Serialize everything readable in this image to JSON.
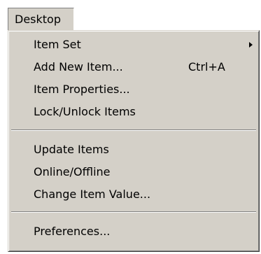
{
  "menubar": {
    "title": "Desktop"
  },
  "menu": {
    "items": [
      {
        "label": "Item Set",
        "shortcut": "",
        "submenu": true
      },
      {
        "label": "Add New Item...",
        "shortcut": "Ctrl+A",
        "submenu": false
      },
      {
        "label": "Item Properties...",
        "shortcut": "",
        "submenu": false
      },
      {
        "label": "Lock/Unlock Items",
        "shortcut": "",
        "submenu": false
      },
      {
        "label": "Update Items",
        "shortcut": "",
        "submenu": false
      },
      {
        "label": "Online/Offline",
        "shortcut": "",
        "submenu": false
      },
      {
        "label": "Change Item Value...",
        "shortcut": "",
        "submenu": false
      },
      {
        "label": "Preferences...",
        "shortcut": "",
        "submenu": false
      }
    ]
  },
  "colors": {
    "menu_face": "#d4d0c8",
    "highlight": "#ffffff",
    "shadow": "#808080",
    "dark_shadow": "#404040",
    "text": "#000000"
  }
}
